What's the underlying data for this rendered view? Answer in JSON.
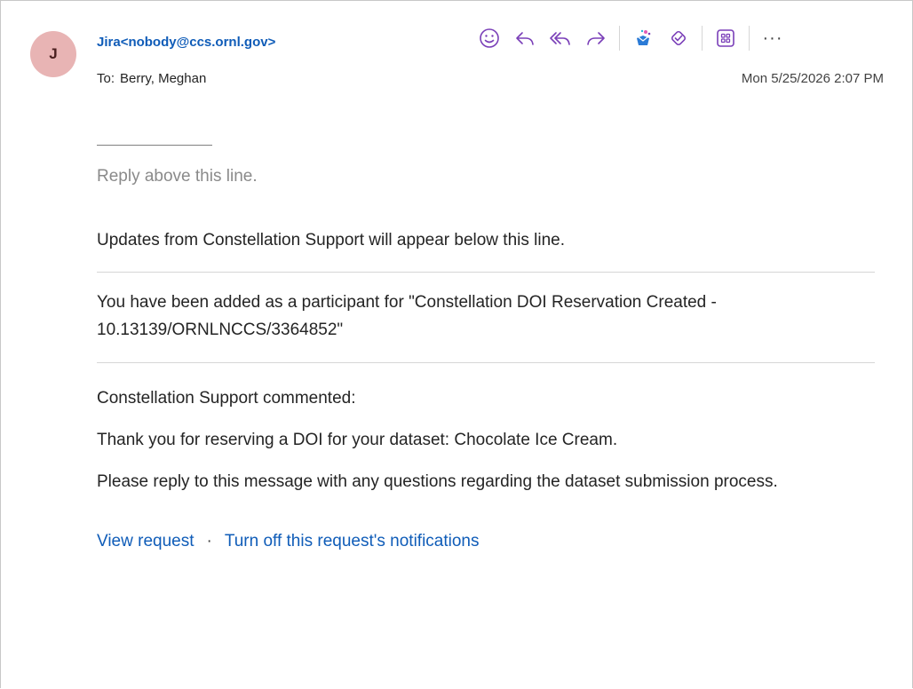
{
  "header": {
    "avatar_initial": "J",
    "sender": "Jira<nobody@ccs.ornl.gov>",
    "to_prefix": "To:",
    "recipient": "Berry, Meghan",
    "timestamp": "Mon 5/25/2026 2:07 PM"
  },
  "toolbar": {
    "icons": [
      "emoji-icon",
      "reply-icon",
      "reply-all-icon",
      "forward-icon",
      "copilot-icon",
      "loop-icon",
      "apps-icon",
      "more-icon"
    ],
    "more_label": "···",
    "accent": "#7a3fb8"
  },
  "body": {
    "reply_above": "Reply above this line.",
    "updates_line": "Updates from Constellation Support will appear below this line.",
    "participant_msg": "You have been added as a participant for \"Constellation DOI Reservation Created - 10.13139/ORNLNCCS/3364852\"",
    "commented": "Constellation Support commented:",
    "thanks": "Thank you for reserving a DOI for your dataset: Chocolate Ice Cream.",
    "please_reply": "Please reply to this message with any questions regarding the dataset submission process.",
    "link_view": "View request",
    "link_dot": "·",
    "link_turnoff": "Turn off this request's notifications"
  },
  "colors": {
    "link": "#0f5cb8",
    "avatar_bg": "#e8b4b4",
    "muted_text": "#8a8a8a"
  }
}
